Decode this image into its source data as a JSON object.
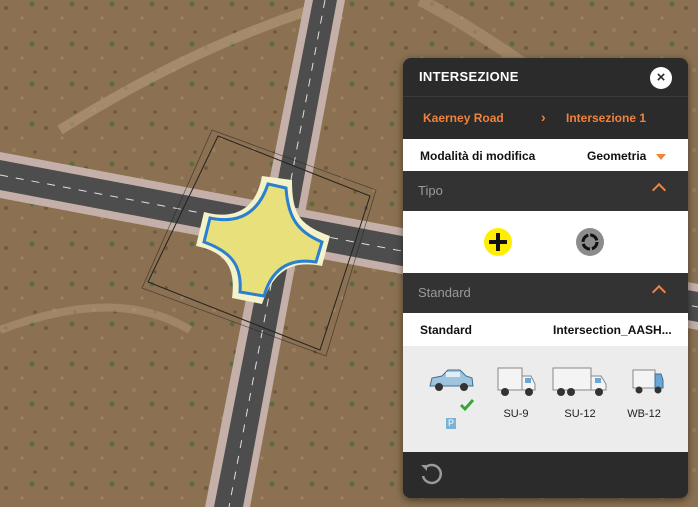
{
  "panel": {
    "title": "INTERSEZIONE",
    "close_glyph": "×",
    "breadcrumb": [
      "Kaerney Road",
      "Intersezione 1"
    ],
    "breadcrumb_separator": "›",
    "edit_mode": {
      "label": "Modalità di modifica",
      "value": "Geometria"
    },
    "sections": {
      "type": {
        "title": "Tipo"
      },
      "standard": {
        "title": "Standard"
      }
    },
    "standard_row": {
      "label": "Standard",
      "value": "Intersection_AASH..."
    },
    "vehicles": [
      {
        "label": "P",
        "selected": true,
        "icon": "car-icon"
      },
      {
        "label": "SU-9",
        "selected": false,
        "icon": "truck-su9-icon"
      },
      {
        "label": "SU-12",
        "selected": false,
        "icon": "truck-su12-icon"
      },
      {
        "label": "WB-12",
        "selected": false,
        "icon": "truck-wb12-icon"
      }
    ],
    "type_icons": [
      "plus-intersection-icon",
      "roundabout-icon"
    ],
    "footer_icon": "undo-icon"
  },
  "colors": {
    "accent": "#f0823c",
    "panel_bg": "#2b2b2b",
    "section_bg": "#333333",
    "intersection_fill": "#e8e07a",
    "intersection_outline": "#2a7fd0",
    "plus_button": "#ffee00",
    "check": "#3aa63a"
  }
}
